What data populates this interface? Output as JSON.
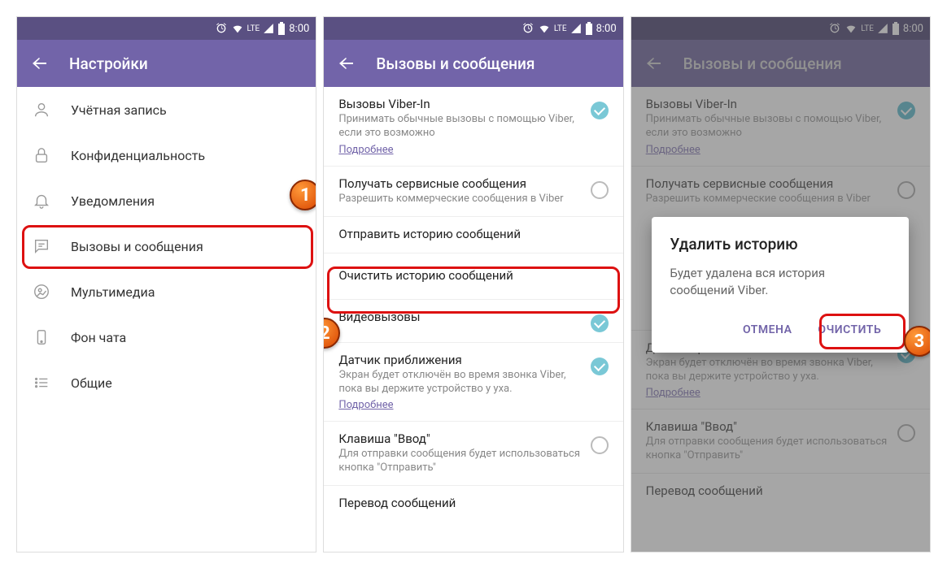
{
  "status": {
    "time": "8:00",
    "lte": "LTE"
  },
  "screen1": {
    "title": "Настройки",
    "items": [
      {
        "label": "Учётная запись"
      },
      {
        "label": "Конфиденциальность"
      },
      {
        "label": "Уведомления"
      },
      {
        "label": "Вызовы и сообщения"
      },
      {
        "label": "Мультимедиа"
      },
      {
        "label": "Фон чата"
      },
      {
        "label": "Общие"
      }
    ]
  },
  "screen2": {
    "title": "Вызовы и сообщения",
    "viberIn": {
      "title": "Вызовы Viber-In",
      "sub": "Принимать обычные вызовы с помощью Viber, если это возможно",
      "link": "Подробнее"
    },
    "service": {
      "title": "Получать сервисные сообщения",
      "sub": "Разрешить коммерческие сообщения в Viber"
    },
    "sendHistory": {
      "title": "Отправить историю сообщений"
    },
    "clearHistory": {
      "title": "Очистить историю сообщений"
    },
    "video": {
      "title": "Видеовызовы"
    },
    "proximity": {
      "title": "Датчик приближения",
      "sub": "Экран будет отключён во время звонка Viber, пока вы держите устройство у уха.",
      "link": "Подробнее"
    },
    "enterKey": {
      "title": "Клавиша \"Ввод\"",
      "sub": "Для отправки сообщения будет использоваться кнопка \"Отправить\""
    },
    "translate": {
      "title": "Перевод сообщений"
    }
  },
  "dialog": {
    "title": "Удалить историю",
    "message": "Будет удалена вся история сообщений Viber.",
    "cancel": "ОТМЕНА",
    "confirm": "ОЧИСТИТЬ"
  },
  "badges": {
    "b1": "1",
    "b2": "2",
    "b3": "3"
  }
}
